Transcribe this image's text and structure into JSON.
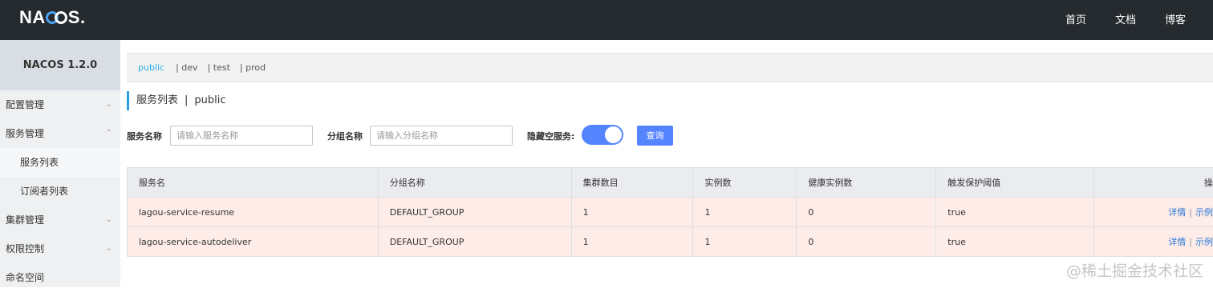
{
  "header": {
    "logo": "NACOS.",
    "nav": [
      "首页",
      "文档",
      "博客"
    ]
  },
  "sidebar": {
    "title": "NACOS 1.2.0",
    "items": [
      {
        "label": "配置管理",
        "chevron": "down"
      },
      {
        "label": "服务管理",
        "chevron": "up"
      },
      {
        "label": "服务列表",
        "sub": true,
        "active": true
      },
      {
        "label": "订阅者列表",
        "sub": true
      },
      {
        "label": "集群管理",
        "chevron": "down"
      },
      {
        "label": "权限控制",
        "chevron": "down"
      },
      {
        "label": "命名空间"
      }
    ]
  },
  "namespaces": {
    "current": "public",
    "others": [
      "| dev",
      "| test",
      "| prod"
    ]
  },
  "page": {
    "title": "服务列表",
    "separator": "|",
    "namespace": "public"
  },
  "filters": {
    "service_name_label": "服务名称",
    "service_name_placeholder": "请输入服务名称",
    "group_name_label": "分组名称",
    "group_name_placeholder": "请输入分组名称",
    "hide_empty_label": "隐藏空服务:",
    "hide_empty_on": true,
    "query_button": "查询"
  },
  "table": {
    "columns": [
      "服务名",
      "分组名称",
      "集群数目",
      "实例数",
      "健康实例数",
      "触发保护阈值",
      "操"
    ],
    "rows": [
      {
        "name": "lagou-service-resume",
        "group": "DEFAULT_GROUP",
        "clusters": "1",
        "instances": "1",
        "healthy": "0",
        "threshold": "true"
      },
      {
        "name": "lagou-service-autodeliver",
        "group": "DEFAULT_GROUP",
        "clusters": "1",
        "instances": "1",
        "healthy": "0",
        "threshold": "true"
      }
    ],
    "op_detail": "详情",
    "op_sep": "|",
    "op_sample": "示例"
  },
  "watermark": "@稀土掘金技术社区",
  "colors": {
    "accent": "#5584ff",
    "link": "#2a79d9",
    "ns_active": "#2ab0e6",
    "row_bg": "#fdece7",
    "topbar": "#252a2f"
  }
}
